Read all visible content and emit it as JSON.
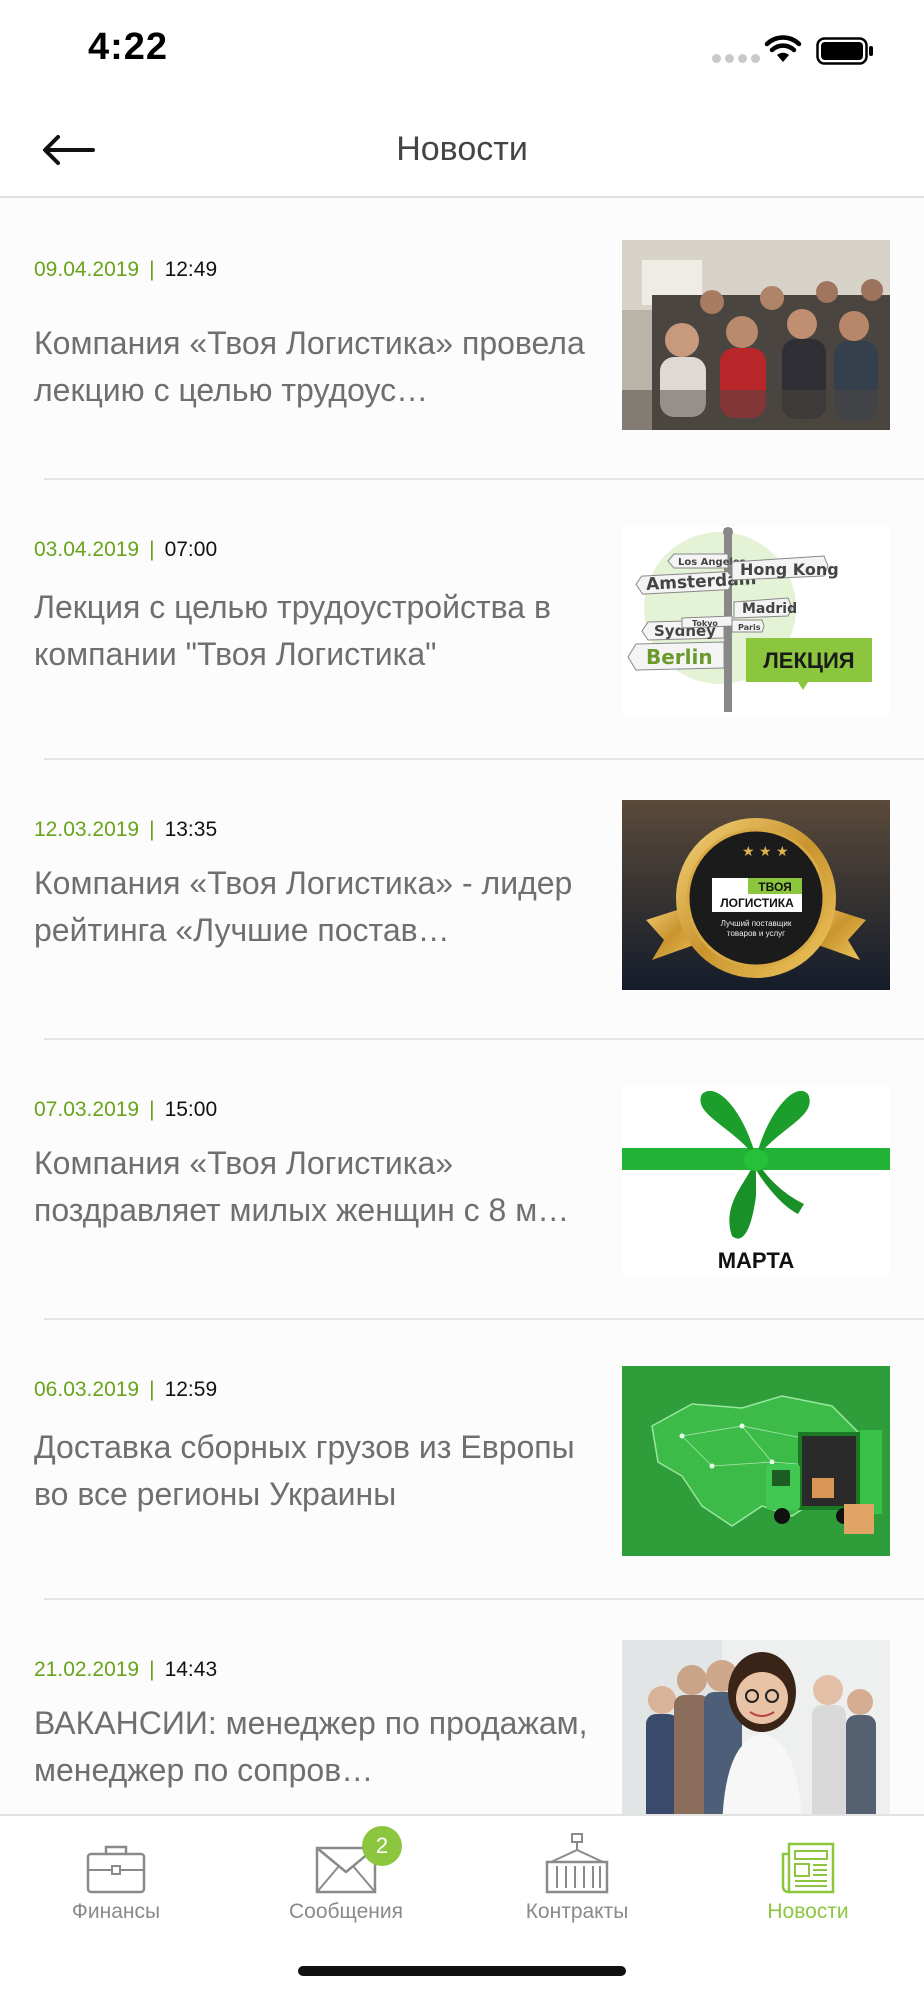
{
  "status_bar": {
    "time": "4:22"
  },
  "header": {
    "title": "Новости"
  },
  "news": [
    {
      "date": "09.04.2019",
      "separator": "|",
      "time": "12:49",
      "title": "Компания «Твоя Логистика» провела лекцию с целью трудоус…",
      "image": "seminar-audience-photo"
    },
    {
      "date": "03.04.2019",
      "separator": "|",
      "time": "07:00",
      "title": "Лекция с целью трудоустройства в компании \"Твоя Логистика\"",
      "image": "signpost-lecture-illustration"
    },
    {
      "date": "12.03.2019",
      "separator": "|",
      "time": "13:35",
      "title": "Компания «Твоя Логистика» - лидер рейтинга «Лучшие постав…",
      "image": "award-badge-illustration"
    },
    {
      "date": "07.03.2019",
      "separator": "|",
      "time": "15:00",
      "title": "Компания «Твоя Логистика» поздравляет милых женщин с 8 м…",
      "image": "green-ribbon-march-illustration"
    },
    {
      "date": "06.03.2019",
      "separator": "|",
      "time": "12:59",
      "title": "Доставка  сборных  грузов из Европы  во все регионы Украины",
      "image": "ukraine-map-truck-illustration"
    },
    {
      "date": "21.02.2019",
      "separator": "|",
      "time": "14:43",
      "title": "ВАКАНСИИ: менеджер по продажам, менеджер по сопров…",
      "image": "team-photo"
    }
  ],
  "images": {
    "signpost_words": [
      "Los Angeles",
      "Amsterdam",
      "Hong Kong",
      "Madrid",
      "Sydney",
      "Berlin",
      "Tokyo",
      "Paris"
    ],
    "lecture_label": "ЛЕКЦИЯ",
    "award_brand_line1": "ТВОЯ",
    "award_brand_line2": "ЛОГИСТИКА",
    "award_text_line1": "Лучший поставщик",
    "award_text_line2": "товаров и услуг",
    "ribbon_caption": "МАРТА"
  },
  "tabs": [
    {
      "label": "Финансы",
      "icon": "briefcase-icon",
      "active": false
    },
    {
      "label": "Сообщения",
      "icon": "envelope-icon",
      "badge": "2",
      "active": false
    },
    {
      "label": "Контракты",
      "icon": "container-crane-icon",
      "active": false
    },
    {
      "label": "Новости",
      "icon": "newspaper-icon",
      "active": true
    }
  ],
  "colors": {
    "accent": "#8cc63f",
    "date_green": "#69a31a",
    "title_gray": "#6f6f6f",
    "tab_gray": "#8a8a8a"
  }
}
